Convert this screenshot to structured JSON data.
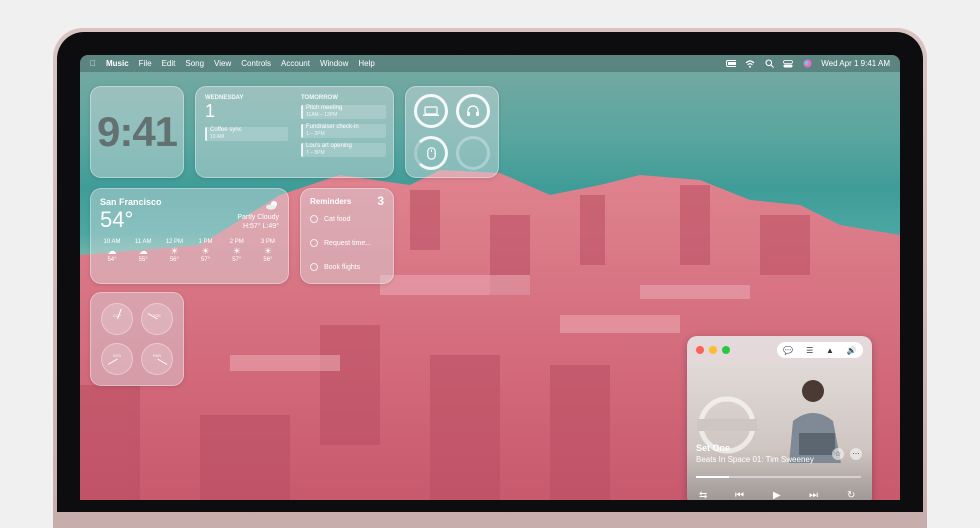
{
  "menubar": {
    "app_name": "Music",
    "menus": [
      "File",
      "Edit",
      "Song",
      "View",
      "Controls",
      "Account",
      "Window",
      "Help"
    ],
    "datetime": "Wed Apr 1  9:41 AM"
  },
  "clock_widget": {
    "time": "9:41"
  },
  "calendar_widget": {
    "today_label": "WEDNESDAY",
    "today_day": "1",
    "tomorrow_label": "TOMORROW",
    "today_events": [
      {
        "title": "Coffee sync",
        "time": "10 AM"
      }
    ],
    "tomorrow_events": [
      {
        "title": "Pitch meeting",
        "time": "11AM – 12PM"
      },
      {
        "title": "Fundraiser check-in",
        "time": "1 – 2PM"
      },
      {
        "title": "Lou's art opening",
        "time": "7 – 8PM"
      }
    ]
  },
  "weather_widget": {
    "city": "San Francisco",
    "temp": "54°",
    "condition": "Partly Cloudy",
    "hilo": "H:57° L:49°",
    "hours": [
      {
        "time": "10 AM",
        "temp": "54°"
      },
      {
        "time": "11 AM",
        "temp": "55°"
      },
      {
        "time": "12 PM",
        "temp": "56°"
      },
      {
        "time": "1 PM",
        "temp": "57°"
      },
      {
        "time": "2 PM",
        "temp": "57°"
      },
      {
        "time": "3 PM",
        "temp": "56°"
      }
    ]
  },
  "reminders_widget": {
    "title": "Reminders",
    "count": "3",
    "items": [
      "Cat food",
      "Request time...",
      "Book flights"
    ]
  },
  "world_clock_widget": {
    "cities": [
      "CUP",
      "TOK",
      "SYD",
      "PAR"
    ]
  },
  "music_player": {
    "set_title": "Set One",
    "track": "Beats In Space 01: Tim Sweeney",
    "progress": 0.2
  },
  "colors": {
    "traffic_red": "#fe5f57",
    "traffic_yellow": "#febc2e",
    "traffic_green": "#28c840"
  }
}
